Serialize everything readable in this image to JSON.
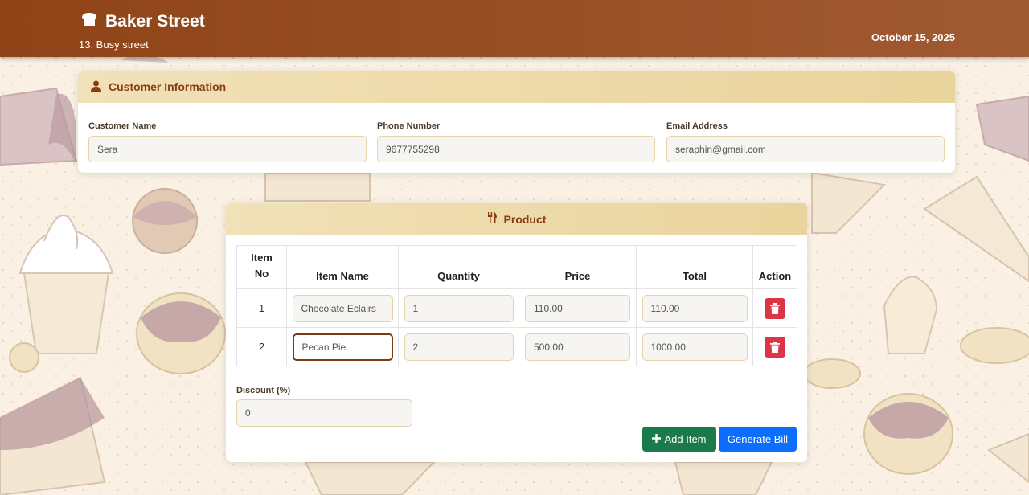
{
  "header": {
    "title": "Baker Street",
    "address": "13, Busy street",
    "date": "October 15, 2025",
    "icon": "bread-icon"
  },
  "customer": {
    "title": "Customer Information",
    "icon": "user-icon",
    "fields": [
      {
        "label": "Customer Name",
        "value": "Sera"
      },
      {
        "label": "Phone Number",
        "value": "9677755298"
      },
      {
        "label": "Email Address",
        "value": "seraphin@gmail.com"
      }
    ]
  },
  "product": {
    "title": "Product",
    "icon": "utensils-icon",
    "columns": [
      "Item No",
      "Item Name",
      "Quantity",
      "Price",
      "Total",
      "Action"
    ],
    "rows": [
      {
        "no": "1",
        "name": "Chocolate Eclairs",
        "quantity": "1",
        "price": "110.00",
        "total": "110.00"
      },
      {
        "no": "2",
        "name": "Pecan Pie",
        "quantity": "2",
        "price": "500.00",
        "total": "1000.00"
      }
    ],
    "discount_label": "Discount (%)",
    "discount_value": "0",
    "add_label": "Add Item",
    "generate_label": "Generate Bill"
  },
  "colors": {
    "header": "#8f4417",
    "card_head": "#ecd9a8",
    "add_button": "#1a7a4c",
    "generate_button": "#0d6efd",
    "delete_button": "#dc3545"
  }
}
